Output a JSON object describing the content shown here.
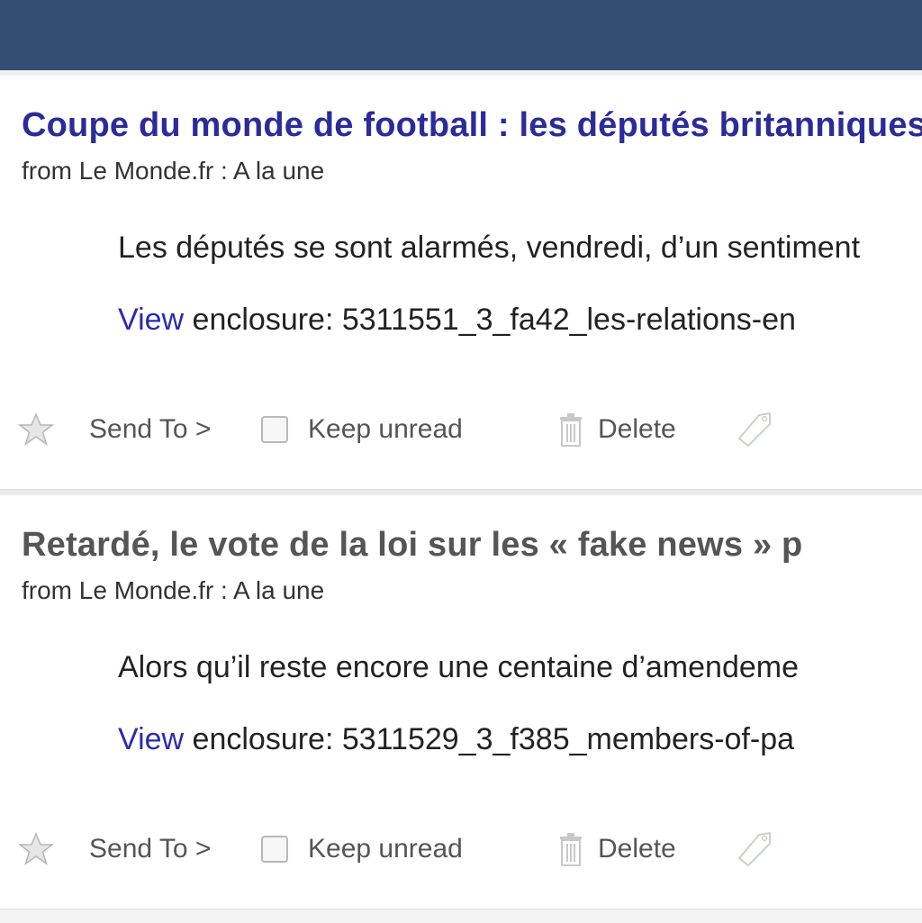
{
  "items": [
    {
      "title": "Coupe du monde de football : les députés britanniques",
      "source": "from Le Monde.fr : A la une",
      "summary": "Les députés se sont alarmés, vendredi, d’un sentiment",
      "enclosure_link": "View",
      "enclosure_text": " enclosure: 5311551_3_fa42_les-relations-en",
      "status": "unread"
    },
    {
      "title": "Retardé, le vote de la loi sur les « fake news » p",
      "source": "from Le Monde.fr : A la une",
      "summary": "Alors qu’il reste encore une centaine d’amendeme",
      "enclosure_link": "View",
      "enclosure_text": " enclosure: 5311529_3_f385_members-of-pa",
      "status": "read"
    }
  ],
  "actions": {
    "send_to": "Send To >",
    "keep_unread": "Keep unread",
    "delete": "Delete"
  },
  "colors": {
    "topbar": "#334d73",
    "unread_title": "#2b2b9a",
    "read_title": "#555555",
    "link": "#2b2bb0"
  }
}
